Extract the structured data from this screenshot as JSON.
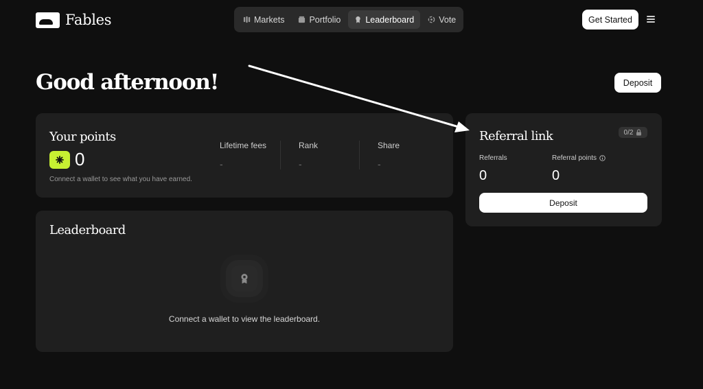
{
  "brand": {
    "name": "Fables",
    "icon": "fables-logo-icon"
  },
  "nav": [
    {
      "label": "Markets",
      "icon": "markets-icon",
      "active": false
    },
    {
      "label": "Portfolio",
      "icon": "portfolio-icon",
      "active": false
    },
    {
      "label": "Leaderboard",
      "icon": "ribbon-icon",
      "active": true
    },
    {
      "label": "Vote",
      "icon": "vote-icon",
      "active": false
    }
  ],
  "header": {
    "cta_label": "Get Started",
    "menu_icon": "hamburger-menu-icon"
  },
  "greeting": "Good afternoon!",
  "deposit_label": "Deposit",
  "points": {
    "title": "Your points",
    "value": "0",
    "badge_icon": "sparkle-icon",
    "badge_color": "#c7f032",
    "caption": "Connect a wallet to see what you have earned.",
    "stats": [
      {
        "label": "Lifetime fees",
        "value": "-"
      },
      {
        "label": "Rank",
        "value": "-"
      },
      {
        "label": "Share",
        "value": "-"
      }
    ]
  },
  "leaderboard": {
    "title": "Leaderboard",
    "empty_icon": "ribbon-icon",
    "empty_text": "Connect a wallet to view the leaderboard."
  },
  "referral": {
    "title": "Referral link",
    "lock_badge": "0/2",
    "lock_icon": "lock-icon",
    "referrals_label": "Referrals",
    "referrals_value": "0",
    "points_label": "Referral points",
    "points_info_icon": "info-icon",
    "points_value": "0",
    "deposit_label": "Deposit"
  }
}
